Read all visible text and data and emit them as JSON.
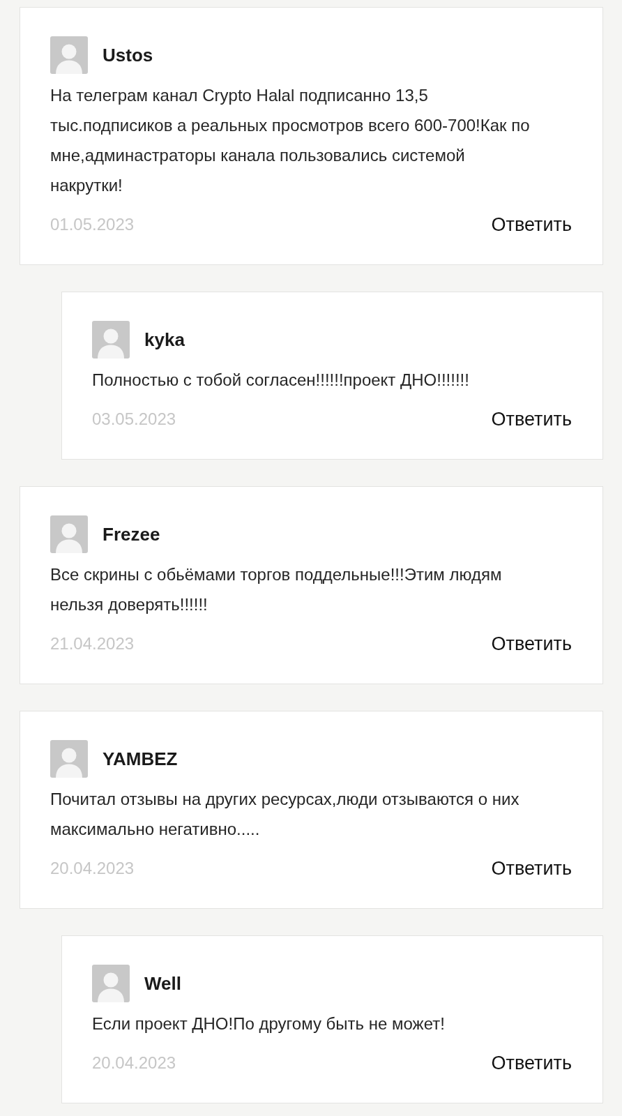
{
  "comments": [
    {
      "author": "Ustos",
      "text": "На телеграм канал Crypto Halal подписанно 13,5 тыс.подписиков а реальных просмотров всего 600-700!Как по мне,админастраторы канала пользовались системой накрутки!",
      "date": "01.05.2023",
      "reply_label": "Ответить",
      "children": [
        {
          "author": "kyka",
          "text": "Полностью с тобой согласен!!!!!!проект ДНО!!!!!!!",
          "date": "03.05.2023",
          "reply_label": "Ответить"
        }
      ]
    },
    {
      "author": "Frezee",
      "text": "Все скрины с обьёмами торгов поддельные!!!Этим людям нельзя доверять!!!!!!",
      "date": "21.04.2023",
      "reply_label": "Ответить"
    },
    {
      "author": "YAMBEZ",
      "text": "Почитал отзывы на других ресурсах,люди отзываются о них максимально негативно.....",
      "date": "20.04.2023",
      "reply_label": "Ответить",
      "children": [
        {
          "author": "Well",
          "text": "Если проект ДНО!По другому быть не может!",
          "date": "20.04.2023",
          "reply_label": "Ответить"
        }
      ]
    }
  ]
}
